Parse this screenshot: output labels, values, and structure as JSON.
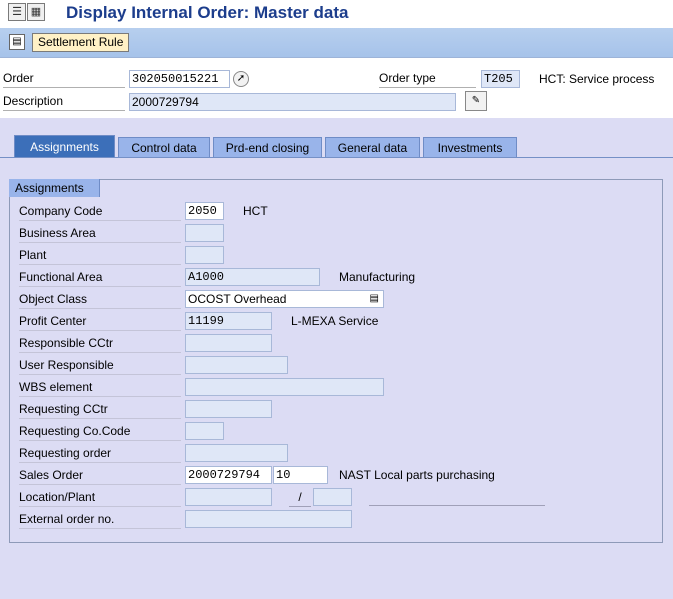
{
  "window": {
    "title": "Display Internal Order: Master data"
  },
  "toolbar": {
    "settlement_rule_label": "Settlement Rule"
  },
  "header": {
    "order_label": "Order",
    "order_value": "302050015221",
    "order_type_label": "Order type",
    "order_type_value": "T205",
    "order_type_text": "HCT: Service process",
    "description_label": "Description",
    "description_value": "2000729794"
  },
  "tabs": [
    {
      "label": "Assignments",
      "active": true
    },
    {
      "label": "Control data"
    },
    {
      "label": "Prd-end closing"
    },
    {
      "label": "General data"
    },
    {
      "label": "Investments"
    }
  ],
  "assignments": {
    "group_title": "Assignments",
    "company_code": {
      "label": "Company Code",
      "value": "2050",
      "text": "HCT"
    },
    "business_area": {
      "label": "Business Area",
      "value": ""
    },
    "plant": {
      "label": "Plant",
      "value": ""
    },
    "functional_area": {
      "label": "Functional Area",
      "value": "A1000",
      "text": "Manufacturing"
    },
    "object_class": {
      "label": "Object Class",
      "value": "OCOST Overhead"
    },
    "profit_center": {
      "label": "Profit Center",
      "value": "11199",
      "text": "L-MEXA Service"
    },
    "responsible_cctr": {
      "label": "Responsible CCtr",
      "value": ""
    },
    "user_responsible": {
      "label": "User Responsible",
      "value": ""
    },
    "wbs_element": {
      "label": "WBS element",
      "value": ""
    },
    "requesting_cctr": {
      "label": "Requesting CCtr",
      "value": ""
    },
    "requesting_cocode": {
      "label": "Requesting Co.Code",
      "value": ""
    },
    "requesting_order": {
      "label": "Requesting order",
      "value": ""
    },
    "sales_order": {
      "label": "Sales Order",
      "value": "2000729794",
      "item": "10",
      "text": "NAST Local parts purchasing"
    },
    "location_plant": {
      "label": "Location/Plant",
      "value": "",
      "separator": "/",
      "value2": ""
    },
    "external_order": {
      "label": "External order no.",
      "value": ""
    }
  }
}
